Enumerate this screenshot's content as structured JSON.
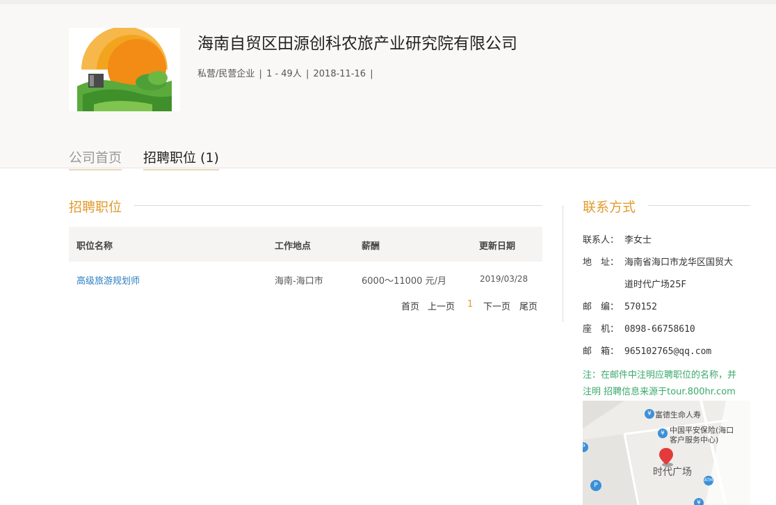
{
  "company": {
    "name": "海南自贸区田源创科农旅产业研究院有限公司",
    "type": "私营/民营企业",
    "size": "1 - 49人",
    "founded": "2018-11-16",
    "separator": "|"
  },
  "tabs": [
    {
      "label": "公司首页",
      "active": false
    },
    {
      "label": "招聘职位 (1)",
      "active": true
    }
  ],
  "jobs_section": {
    "title": "招聘职位",
    "columns": [
      "职位名称",
      "工作地点",
      "薪酬",
      "更新日期"
    ],
    "rows": [
      {
        "title": "高级旅游规划师",
        "location": "海南-海口市",
        "salary": "6000～11000 元/月",
        "date": "2019/03/28"
      }
    ],
    "pager": {
      "first": "首页",
      "prev": "上一页",
      "current": "1",
      "next": "下一页",
      "last": "尾页"
    }
  },
  "contact_section": {
    "title": "联系方式",
    "rows": [
      {
        "label": "联系人：",
        "value": "李女士"
      },
      {
        "label": "地　址：",
        "value": "海南省海口市龙华区国贸大",
        "value2": "道时代广场25F"
      },
      {
        "label": "邮　编：",
        "value": "570152"
      },
      {
        "label": "座　机：",
        "value": "0898-66758610"
      },
      {
        "label": "邮　箱：",
        "value": "965102765@qq.com"
      }
    ],
    "note_line1": "注：在邮件中注明应聘职位的名称，并",
    "note_line2": "注明 招聘信息来源于tour.800hr.com"
  },
  "map": {
    "poi1": "富德生命人寿",
    "poi2_line1": "中国平安保险(海口",
    "poi2_line2": "客户服务中心)",
    "plaza": "时代广场",
    "poi_symbol": "¥",
    "parking_symbol": "P",
    "atm_symbol": "ATM"
  },
  "colors": {
    "accent": "#e39a2c",
    "link": "#2a7ec1",
    "note": "#3aa86b",
    "pin": "#e23b3b"
  }
}
